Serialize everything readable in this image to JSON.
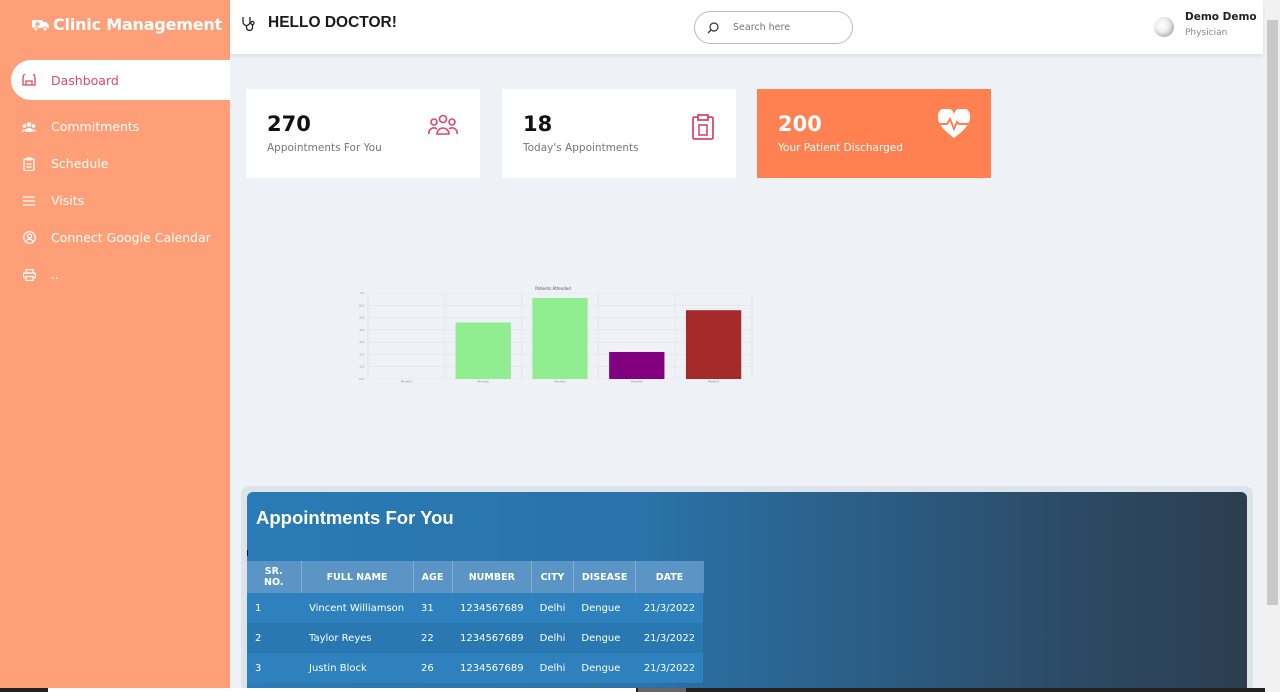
{
  "app": {
    "title": "Clinic Management"
  },
  "sidebar": {
    "items": [
      {
        "label": "Dashboard",
        "icon": "dashboard-icon",
        "active": true
      },
      {
        "label": "Commitments",
        "icon": "group-icon"
      },
      {
        "label": "Schedule",
        "icon": "clipboard-icon"
      },
      {
        "label": "Visits",
        "icon": "menu-lines-icon"
      },
      {
        "label": "Connect Google Calendar",
        "icon": "user-circle-icon"
      },
      {
        "label": "..",
        "icon": "printer-icon"
      }
    ]
  },
  "header": {
    "greeting": "HELLO DOCTOR!",
    "search_placeholder": "Search here",
    "user_name": "Demo Demo",
    "user_role": "Physician"
  },
  "cards": [
    {
      "value": "270",
      "label": "Appointments For You",
      "icon": "people-icon"
    },
    {
      "value": "18",
      "label": "Today's Appointments",
      "icon": "clipboard-icon"
    },
    {
      "value": "200",
      "label": "Your Patient Discharged",
      "icon": "heart-pulse-icon"
    }
  ],
  "chart_data": {
    "type": "bar",
    "title": "Patients Attended",
    "categories": [
      "Month1",
      "Month2",
      "Month3",
      "Month4",
      "Month5"
    ],
    "values": [
      0,
      4.6,
      6.6,
      2.2,
      5.6
    ],
    "colors": [
      "#90ee90",
      "#90ee90",
      "#90ee90",
      "#800080",
      "#a52a2a"
    ],
    "ylim": [
      0,
      7
    ],
    "grid": true
  },
  "appointments": {
    "title": "Appointments For You",
    "columns": [
      "SR. NO.",
      "FULL NAME",
      "AGE",
      "NUMBER",
      "CITY",
      "DISEASE",
      "DATE"
    ],
    "rows": [
      [
        "1",
        "Vincent Williamson",
        "31",
        "1234567689",
        "Delhi",
        "Dengue",
        "21/3/2022"
      ],
      [
        "2",
        "Taylor Reyes",
        "22",
        "1234567689",
        "Delhi",
        "Dengue",
        "21/3/2022"
      ],
      [
        "3",
        "Justin Block",
        "26",
        "1234567689",
        "Delhi",
        "Dengue",
        "21/3/2022"
      ]
    ]
  },
  "colors": {
    "sidebar": "#ff9f78",
    "accent": "#d9486d",
    "orange_card": "#ff8151"
  }
}
